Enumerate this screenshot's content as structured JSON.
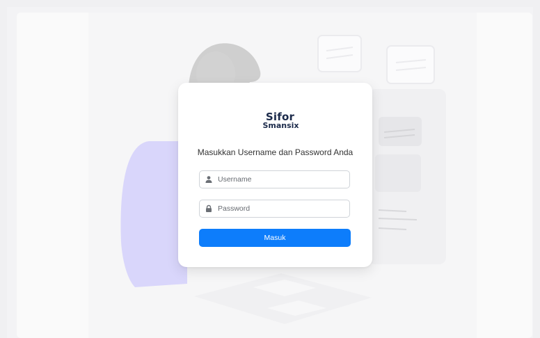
{
  "login": {
    "logo_line1": "Sifor",
    "logo_line2": "Smansix",
    "subtitle": "Masukkan Username dan Password Anda",
    "username": {
      "placeholder": "Username",
      "value": "",
      "icon": "user-icon"
    },
    "password": {
      "placeholder": "Password",
      "value": "",
      "icon": "lock-icon"
    },
    "submit_label": "Masuk"
  },
  "colors": {
    "accent": "#0d7dfb",
    "illustration_purple": "#d9d6fb",
    "illustration_gray": "#cfcfcf",
    "logo": "#1b2a4a"
  }
}
